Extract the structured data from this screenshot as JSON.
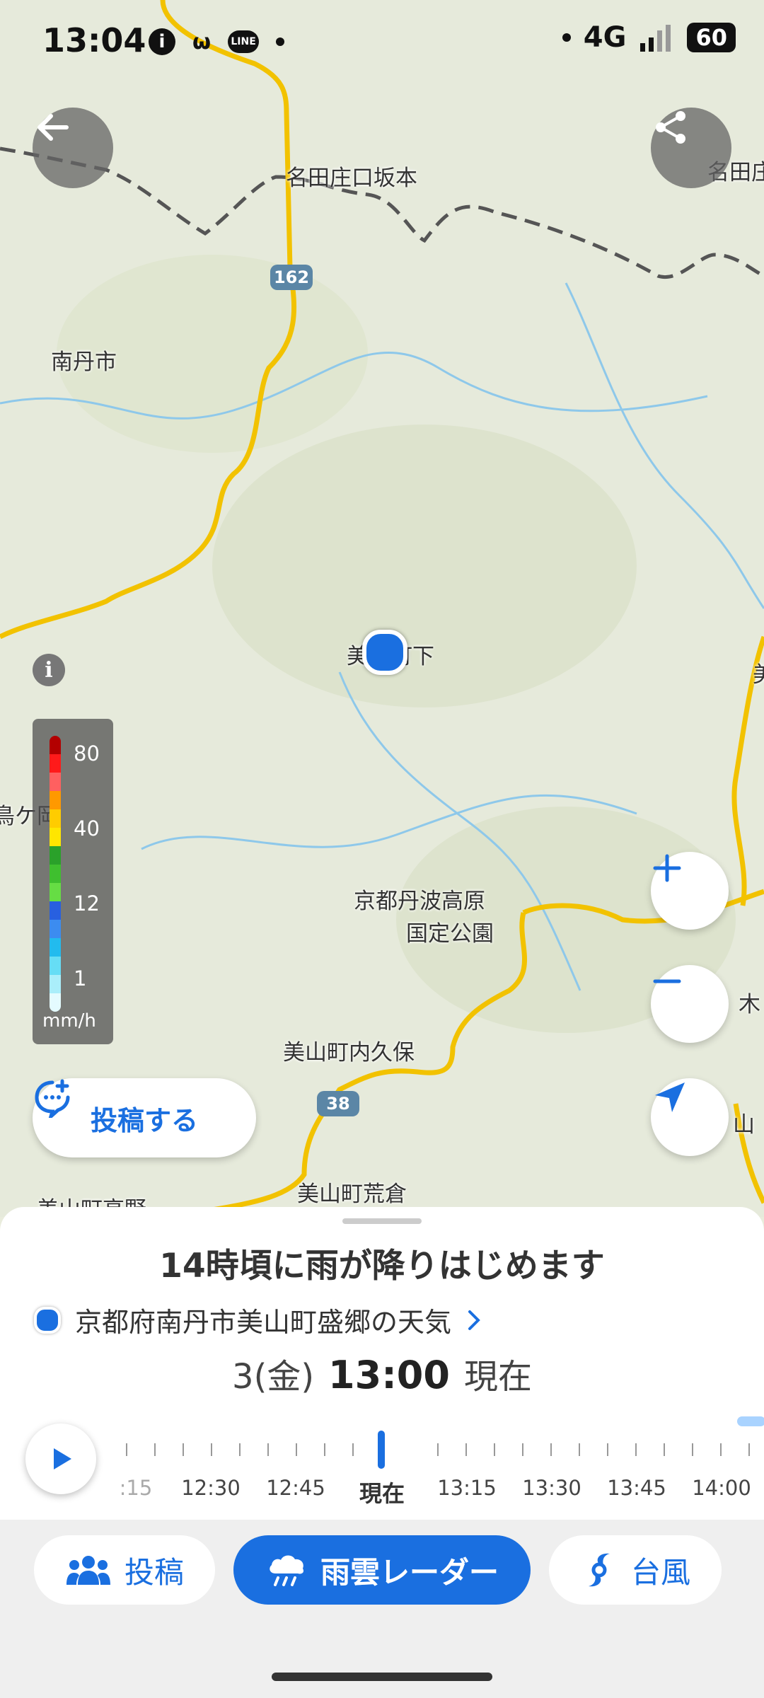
{
  "status_bar": {
    "time": "13:04",
    "network": "4G",
    "battery": "60",
    "app_icons": [
      "info-icon",
      "app-icon",
      "line-icon",
      "dot-icon"
    ]
  },
  "map": {
    "labels": [
      "名田庄口坂本",
      "名田庄",
      "南丹市",
      "美山町下",
      "京都丹波高原",
      "国定公園",
      "美山町内久保",
      "美山町荒倉",
      "美山町高野",
      "鳥ケ岡",
      "美",
      "木",
      "山"
    ],
    "road_numbers": [
      "162",
      "38"
    ]
  },
  "legend": {
    "levels": [
      "80",
      "40",
      "12",
      "1"
    ],
    "unit": "mm/h"
  },
  "post_button": {
    "label": "投稿する"
  },
  "sheet": {
    "headline": "14時頃に雨が降りはじめます",
    "location": "京都府南丹市美山町盛郷の天気",
    "date": "3(金)",
    "time": "13:00",
    "current_label": "現在"
  },
  "timeline": {
    "labels": [
      ":15",
      "12:30",
      "12:45",
      "現在",
      "13:15",
      "13:30",
      "13:45",
      "14:00"
    ]
  },
  "tabs": [
    {
      "label": "投稿",
      "icon": "people-icon"
    },
    {
      "label": "雨雲レーダー",
      "icon": "rain-cloud-icon"
    },
    {
      "label": "台風",
      "icon": "typhoon-icon"
    }
  ],
  "colors": {
    "accent": "#1a6fe0",
    "road": "#f2c200",
    "river": "#8ec8ea"
  }
}
